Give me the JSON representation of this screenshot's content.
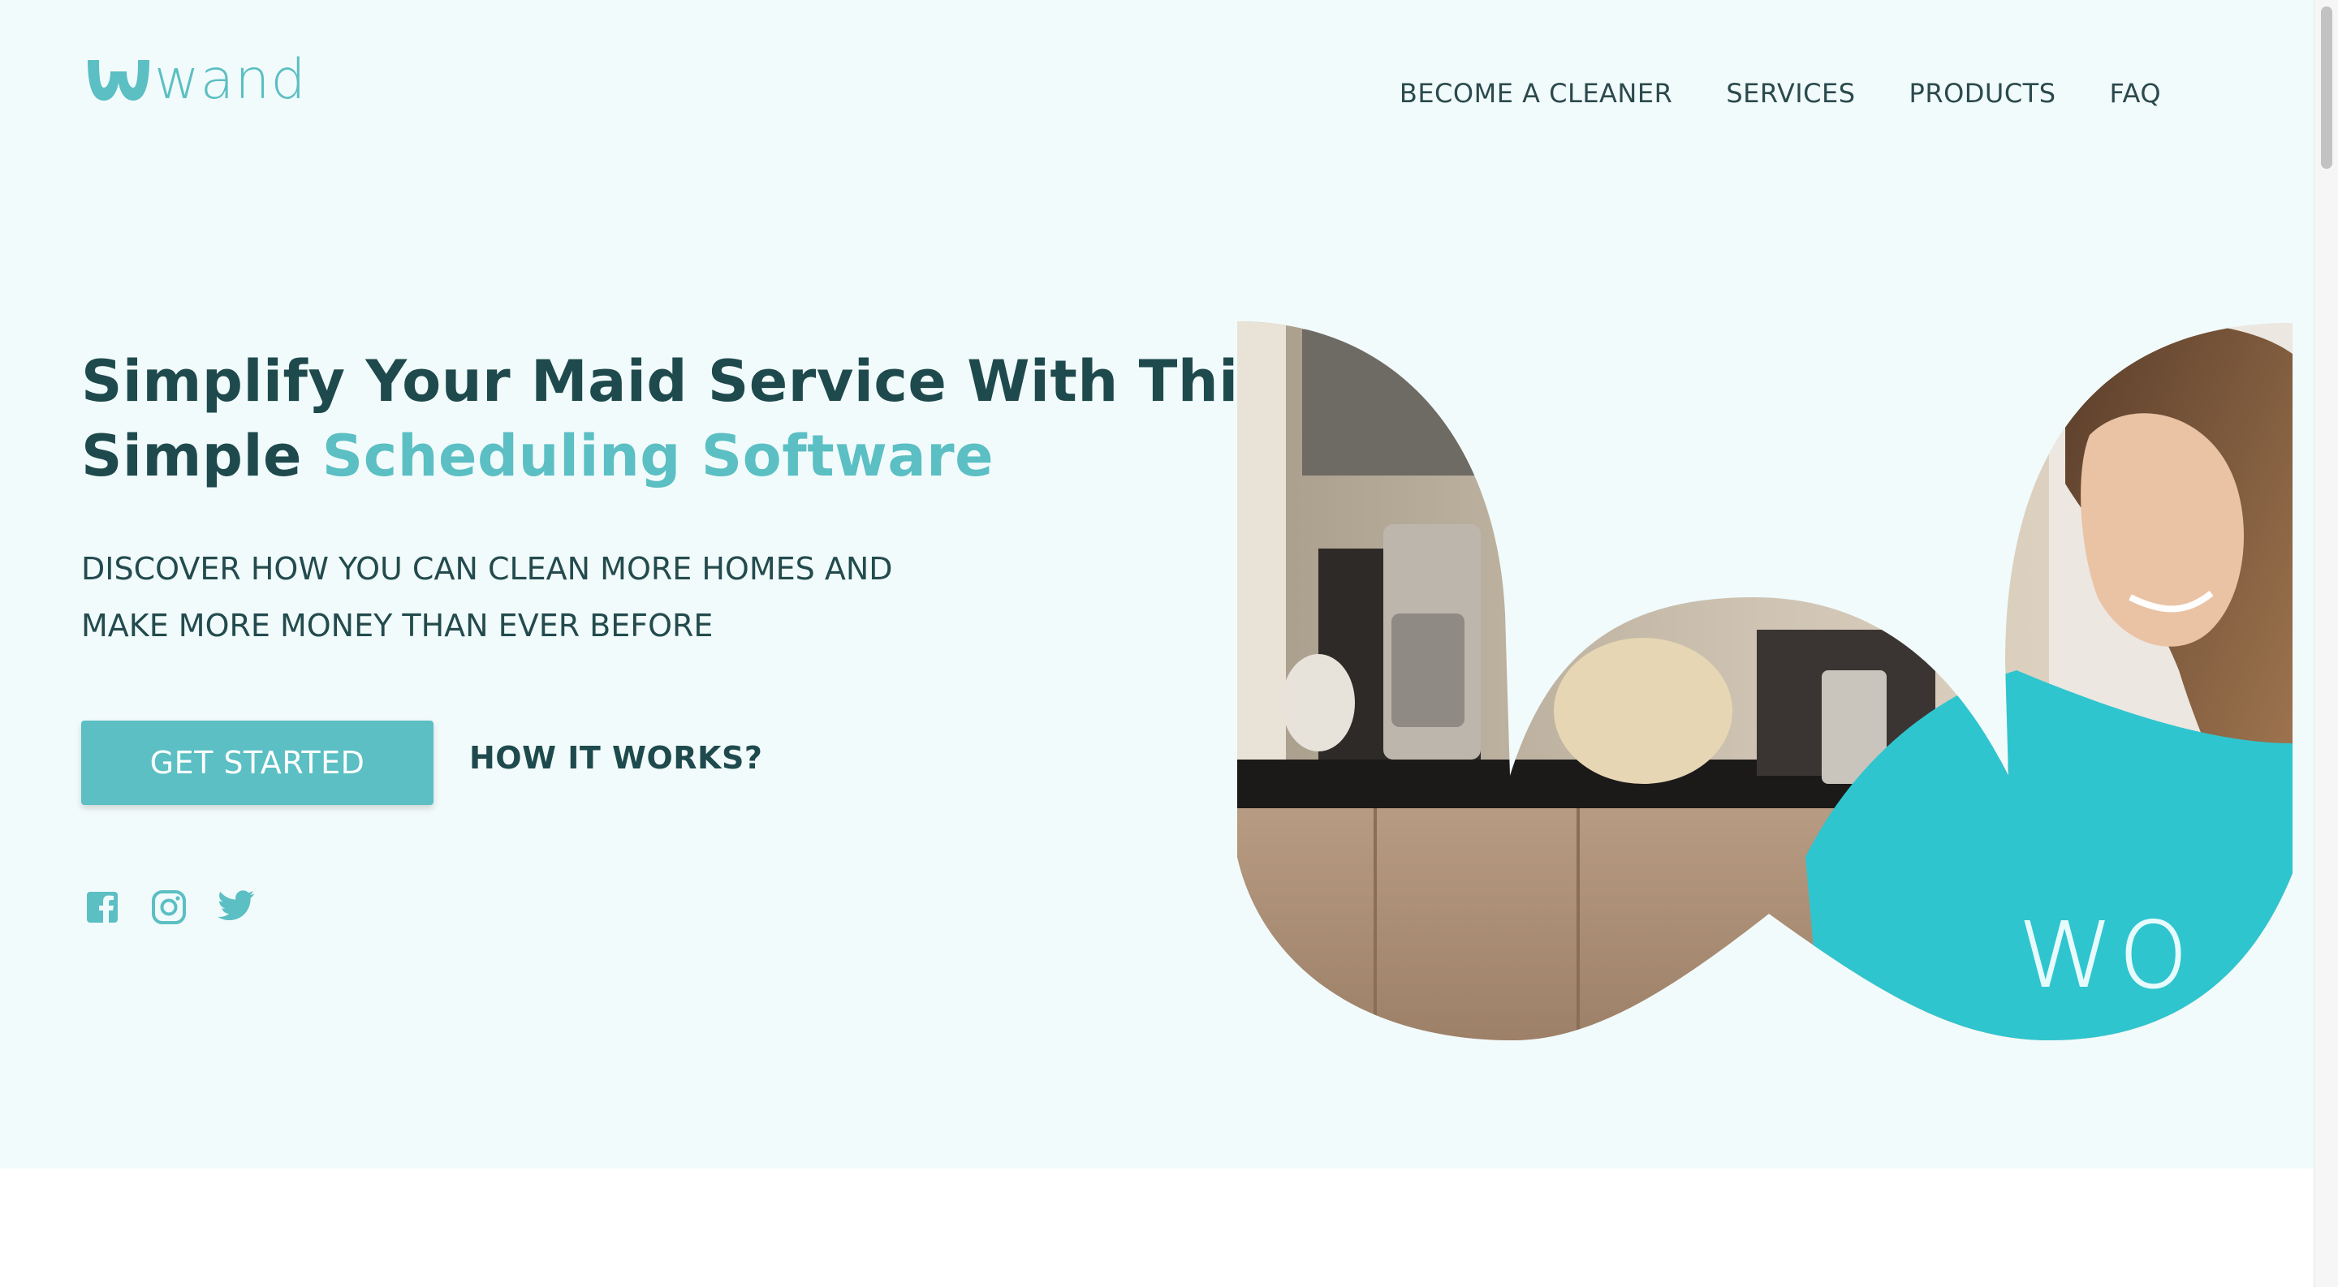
{
  "brand": {
    "name": "wand",
    "color": "#5bbfc4",
    "dark": "#1e4a4d"
  },
  "nav": {
    "items": [
      {
        "label": "BECOME A CLEANER"
      },
      {
        "label": "SERVICES"
      },
      {
        "label": "PRODUCTS"
      },
      {
        "label": "FAQ"
      }
    ]
  },
  "hero": {
    "headline_line1": "Simplify Your Maid Service With This",
    "headline_line2_plain": "Simple ",
    "headline_line2_accent": "Scheduling Software",
    "subtitle_line1": "DISCOVER HOW YOU CAN CLEAN MORE HOMES AND",
    "subtitle_line2": "MAKE MORE MONEY THAN EVER BEFORE",
    "cta_label": "GET STARTED",
    "secondary_label": "HOW IT WORKS?"
  },
  "social": {
    "icons": [
      "facebook-icon",
      "instagram-icon",
      "twitter-icon"
    ]
  }
}
